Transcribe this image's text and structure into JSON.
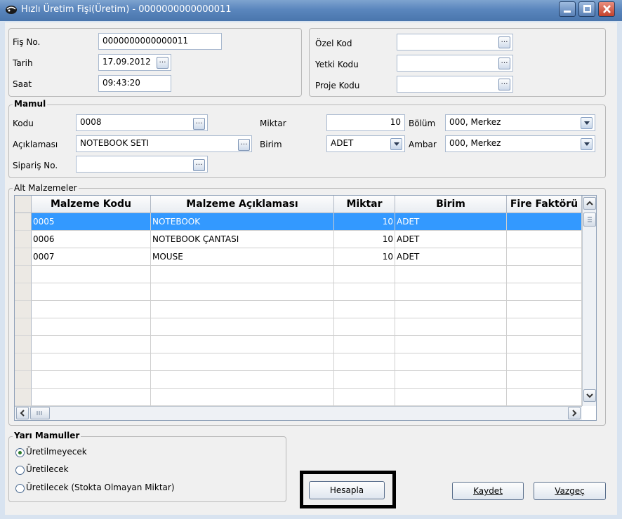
{
  "window": {
    "title": "Hızlı Üretim Fişi(Üretim) - 0000000000000011"
  },
  "header": {
    "fis_no_label": "Fiş No.",
    "fis_no": "0000000000000011",
    "tarih_label": "Tarih",
    "tarih": "17.09.2012",
    "saat_label": "Saat",
    "saat": "09:43:20",
    "ozel_kod_label": "Özel Kod",
    "ozel_kod": "",
    "yetki_kodu_label": "Yetki Kodu",
    "yetki_kodu": "",
    "proje_kodu_label": "Proje Kodu",
    "proje_kodu": ""
  },
  "mamul": {
    "legend": "Mamul",
    "kodu_label": "Kodu",
    "kodu": "0008",
    "aciklama_label": "Açıklaması",
    "aciklama": "NOTEBOOK SETI",
    "siparis_label": "Sipariş No.",
    "siparis": "",
    "miktar_label": "Miktar",
    "miktar": "10",
    "birim_label": "Birim",
    "birim": "ADET",
    "bolum_label": "Bölüm",
    "bolum": "000, Merkez",
    "ambar_label": "Ambar",
    "ambar": "000, Merkez"
  },
  "alt_malzemeler": {
    "legend": "Alt Malzemeler",
    "columns": [
      "Malzeme Kodu",
      "Malzeme Açıklaması",
      "Miktar",
      "Birim",
      "Fire Faktörü"
    ],
    "rows": [
      {
        "kod": "0005",
        "aciklama": "NOTEBOOK",
        "miktar": "10",
        "birim": "ADET",
        "fire": ""
      },
      {
        "kod": "0006",
        "aciklama": "NOTEBOOK ÇANTASI",
        "miktar": "10",
        "birim": "ADET",
        "fire": ""
      },
      {
        "kod": "0007",
        "aciklama": "MOUSE",
        "miktar": "10",
        "birim": "ADET",
        "fire": ""
      }
    ]
  },
  "yari_mamuller": {
    "legend": "Yarı Mamuller",
    "options": [
      "Üretilmeyecek",
      "Üretilecek",
      "Üretilecek (Stokta Olmayan Miktar)"
    ],
    "selected_index": 0
  },
  "buttons": {
    "hesapla": "Hesapla",
    "kaydet": "Kaydet",
    "vazgec": "Vazgeç"
  },
  "colors": {
    "selection": "#3399ff",
    "highlight_box": "#000000"
  },
  "icons": {
    "ellipsis": "…",
    "app": "app-icon"
  }
}
